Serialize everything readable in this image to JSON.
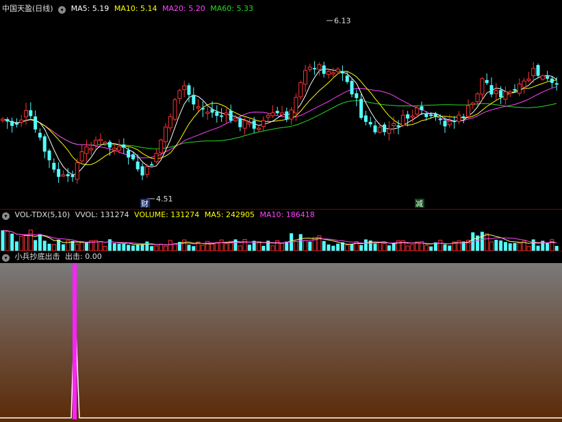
{
  "main": {
    "title": "中国天盈(日线)",
    "ma5_label": "MA5: 5.19",
    "ma10_label": "MA10: 5.14",
    "ma20_label": "MA20: 5.20",
    "ma60_label": "MA60: 5.33",
    "high_marker": "6.13",
    "low_marker": "4.51",
    "event_cai": "财",
    "event_jian": "减",
    "colors": {
      "up": "#ff3333",
      "down": "#54ffff",
      "ma5": "#ffffff",
      "ma10": "#ffff00",
      "ma20": "#ff44ff",
      "ma60": "#22dd22"
    }
  },
  "volume": {
    "title": "VOL-TDX(5,10)",
    "vvol_label": "VVOL: 131274",
    "volume_label": "VOLUME: 131274",
    "ma5_label": "MA5: 242905",
    "ma10_label": "MA10: 186418"
  },
  "indicator": {
    "title": "小兵抄底出击",
    "out_label": "出击: 0.00"
  },
  "icons": {
    "collapse": "chevron-down-icon"
  }
}
